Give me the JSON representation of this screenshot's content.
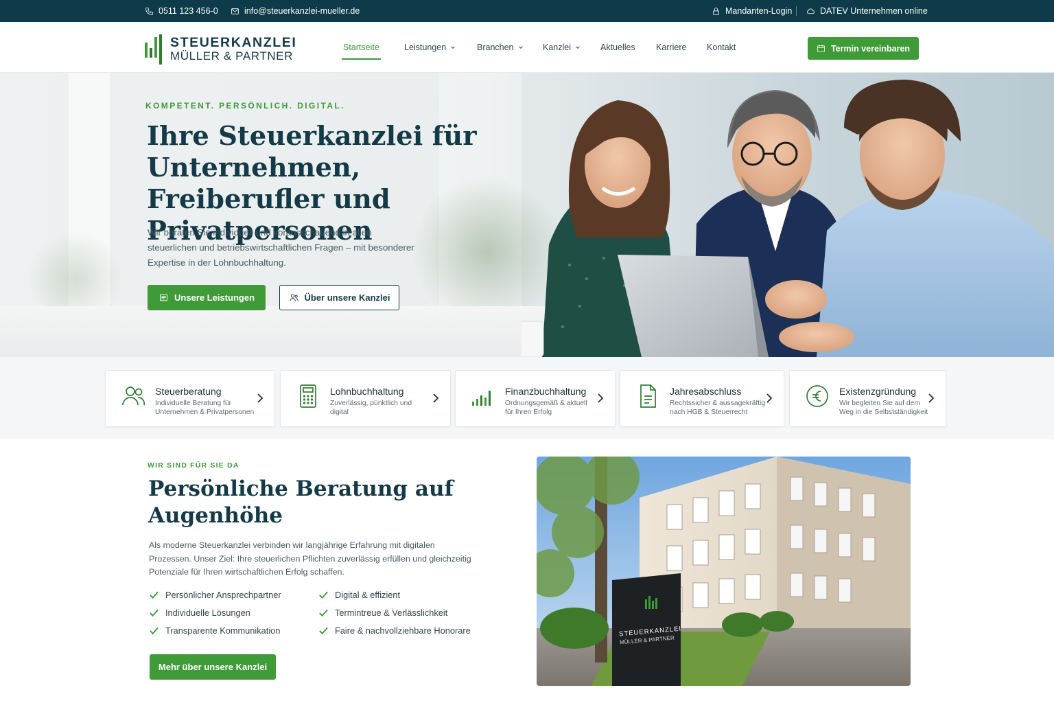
{
  "topbar": {
    "phone": "0511 123 456-0",
    "email": "info@steuerkanzlei-mueller.de",
    "login": "Mandanten-Login",
    "datev": "DATEV Unternehmen online"
  },
  "brand": {
    "name_line1": "STEUERKANZLEI",
    "name_line2": "MÜLLER & PARTNER",
    "accent_color": "#3e9b37",
    "primary_color": "#143a48"
  },
  "nav": {
    "items": [
      {
        "label": "Startseite",
        "active": true
      },
      {
        "label": "Leistungen",
        "dropdown": true
      },
      {
        "label": "Branchen",
        "dropdown": true
      },
      {
        "label": "Kanzlei",
        "dropdown": true
      },
      {
        "label": "Aktuelles"
      },
      {
        "label": "Karriere"
      },
      {
        "label": "Kontakt"
      }
    ],
    "cta": "Termin vereinbaren"
  },
  "hero": {
    "eyebrow": "KOMPETENT. PERSÖNLICH. DIGITAL.",
    "title": "Ihre Steuerkanzlei für Unternehmen, Freiberufler und Privatpersonen",
    "text": "Wir beraten Sie individuell und vorausschauend in allen steuerlichen und betriebswirtschaftlichen Fragen – mit besonderer Expertise in der Lohnbuchhaltung.",
    "btn_primary": "Unsere Leistungen",
    "btn_secondary": "Über unsere Kanzlei"
  },
  "services": [
    {
      "title": "Steuerberatung",
      "desc": "Individuelle Beratung für Unternehmen & Privatpersonen",
      "icon": "people-icon"
    },
    {
      "title": "Lohnbuchhaltung",
      "desc": "Zuverlässig, pünktlich und digital",
      "icon": "calculator-icon"
    },
    {
      "title": "Finanzbuchhaltung",
      "desc": "Ordnungsgemäß & aktuell für Ihren Erfolg",
      "icon": "bar-chart-icon"
    },
    {
      "title": "Jahresabschluss",
      "desc": "Rechtssicher & aussagekräftig nach HGB & Steuerrecht",
      "icon": "document-icon"
    },
    {
      "title": "Existenzgründung",
      "desc": "Wir begleiten Sie auf dem Weg in die Selbstständigkeit",
      "icon": "euro-icon"
    }
  ],
  "about": {
    "eyebrow": "WIR SIND FÜR SIE DA",
    "title": "Persönliche Beratung auf Augenhöhe",
    "text": "Als moderne Steuerkanzlei verbinden wir langjährige Erfahrung mit digitalen Prozessen. Unser Ziel: Ihre steuerlichen Pflichten zuverlässig erfüllen und gleichzeitig Potenziale für Ihren wirtschaftlichen Erfolg schaffen.",
    "checks_left": [
      "Persönlicher Ansprechpartner",
      "Individuelle Lösungen",
      "Transparente Kommunikation"
    ],
    "checks_right": [
      "Digital & effizient",
      "Termintreue & Verlässlichkeit",
      "Faire & nachvollziehbare Honorare"
    ],
    "button": "Mehr über unsere Kanzlei",
    "sign_line1": "STEUERKANZLEI",
    "sign_line2": "MÜLLER & PARTNER"
  }
}
